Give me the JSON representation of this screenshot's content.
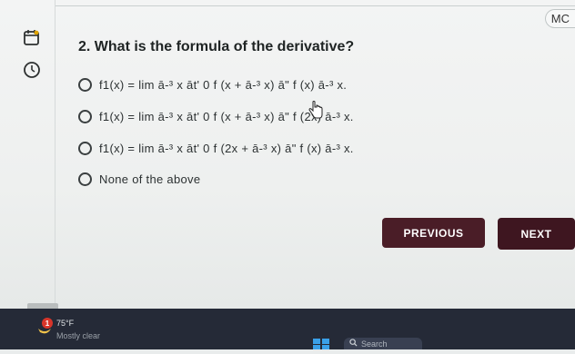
{
  "header": {
    "tag": "MC"
  },
  "rail": {
    "icons": [
      "calendar-icon",
      "clock-icon"
    ]
  },
  "question": {
    "number_text": "2. What is the formula of the derivative?",
    "options": [
      {
        "label": "f1(x) = lim ā-³ x āt' 0 f (x + ā-³ x) ā\" f (x) ā-³ x.",
        "selected": false
      },
      {
        "label": "f1(x) = lim ā-³ x āt' 0 f (x + ā-³ x) ā\" f (2x) ā-³ x.",
        "selected": false
      },
      {
        "label": "f1(x) = lim ā-³ x āt' 0 f (2x + ā-³ x) ā\" f (x) ā-³ x.",
        "selected": false
      },
      {
        "label": "None of the above",
        "selected": false
      }
    ]
  },
  "buttons": {
    "previous": "PREVIOUS",
    "next": "NEXT"
  },
  "taskbar": {
    "notification_count": "1",
    "temperature": "75°F",
    "condition": "Mostly clear",
    "search_label": "Search"
  },
  "colors": {
    "prev_button": "#4a1d27",
    "next_button": "#3e1620",
    "taskbar": "#252a37"
  }
}
